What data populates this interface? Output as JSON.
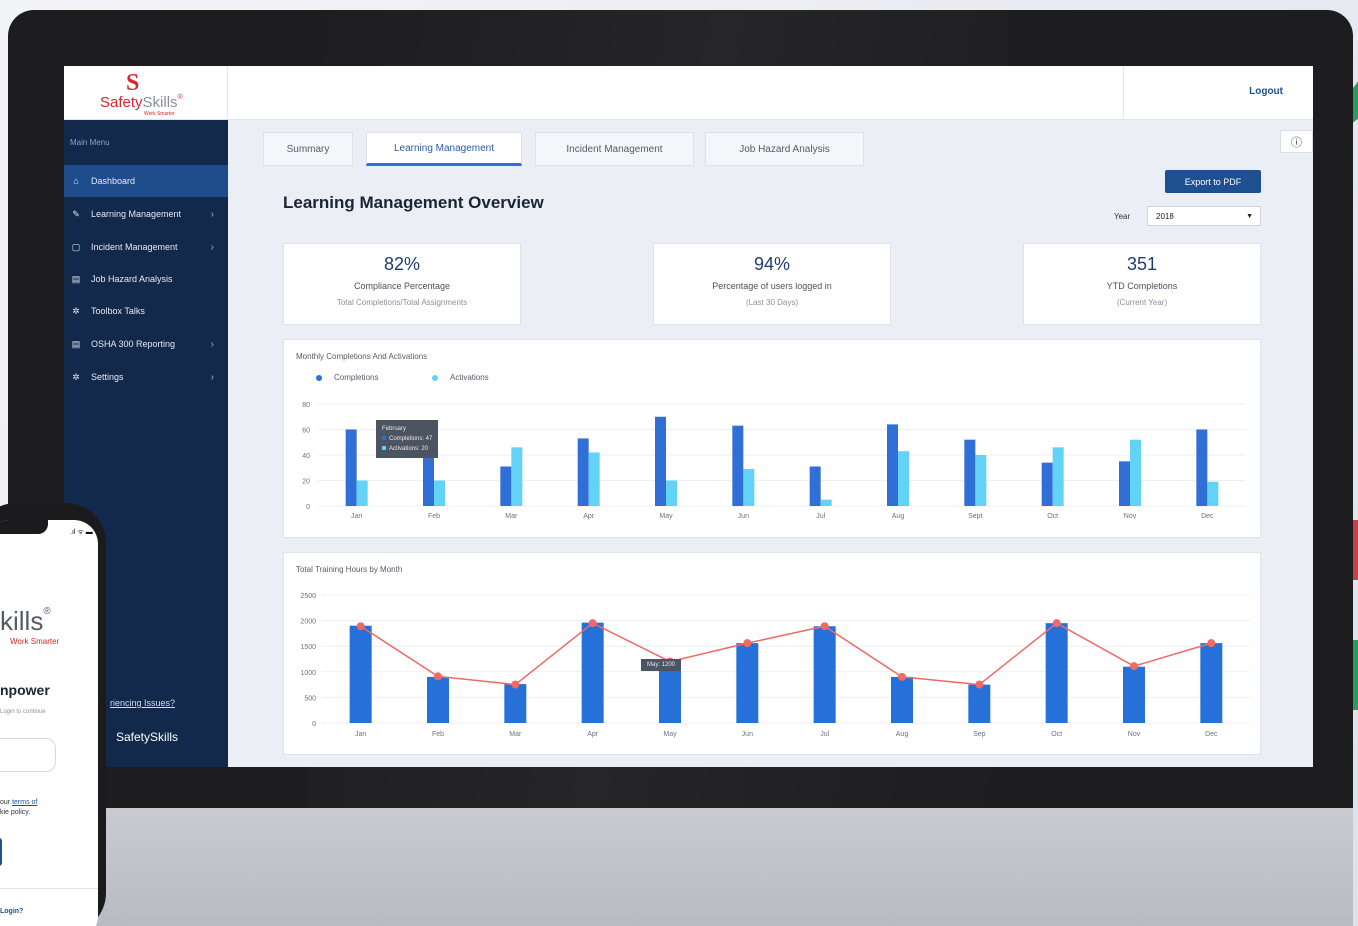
{
  "app": {
    "logo_mark": "S",
    "logo_brand_a": "Safety",
    "logo_brand_b": "Skills",
    "logo_registered": "®",
    "logo_tagline": "Work Smarter",
    "logout": "Logout"
  },
  "sidebar": {
    "heading": "Main Menu",
    "items": [
      {
        "label": "Dashboard",
        "icon": "home-icon",
        "glyph": "⌂",
        "chevron": ""
      },
      {
        "label": "Learning Management",
        "icon": "graduation-cap-icon",
        "glyph": "✎",
        "chevron": "›"
      },
      {
        "label": "Incident Management",
        "icon": "square-icon",
        "glyph": "▢",
        "chevron": "›"
      },
      {
        "label": "Job Hazard Analysis",
        "icon": "clipboard-icon",
        "glyph": "▤",
        "chevron": ""
      },
      {
        "label": "Toolbox Talks",
        "icon": "gear-icon",
        "glyph": "✲",
        "chevron": ""
      },
      {
        "label": "OSHA 300 Reporting",
        "icon": "document-icon",
        "glyph": "▤",
        "chevron": "›"
      },
      {
        "label": "Settings",
        "icon": "settings-icon",
        "glyph": "✲",
        "chevron": "›"
      }
    ],
    "issues_link": "riencing Issues?",
    "footer_logo": "SafetySkills"
  },
  "tabs": [
    {
      "label": "Summary"
    },
    {
      "label": "Learning Management"
    },
    {
      "label": "Incident Management"
    },
    {
      "label": "Job Hazard Analysis"
    }
  ],
  "info_glyph": "ⓘ",
  "page_title": "Learning Management Overview",
  "export_label": "Export to PDF",
  "year": {
    "label": "Year",
    "value": "2018",
    "caret": "▼"
  },
  "kpis": [
    {
      "value": "82%",
      "label": "Compliance Percentage",
      "sub": "Total Completions/Total Assignments"
    },
    {
      "value": "94%",
      "label": "Percentage of users logged in",
      "sub": "(Last 30 Days)"
    },
    {
      "value": "351",
      "label": "YTD Completions",
      "sub": "(Current Year)"
    }
  ],
  "colors": {
    "completions": "#2f6fd6",
    "activations": "#62d3f7",
    "hours_bar": "#2571d9",
    "hours_line": "#ef6a66"
  },
  "chart_data": [
    {
      "type": "bar",
      "title": "Monthly Completions And Activations",
      "categories": [
        "Jan",
        "Feb",
        "Mar",
        "Apr",
        "May",
        "Jun",
        "Jul",
        "Aug",
        "Sept",
        "Oct",
        "Nov",
        "Dec"
      ],
      "series": [
        {
          "name": "Completions",
          "values": [
            60,
            47,
            31,
            53,
            70,
            63,
            31,
            64,
            52,
            34,
            35,
            60
          ]
        },
        {
          "name": "Activations",
          "values": [
            20,
            20,
            46,
            42,
            20,
            29,
            5,
            43,
            40,
            46,
            52,
            19
          ]
        }
      ],
      "yticks": [
        0,
        20,
        40,
        60,
        80
      ],
      "ylim": [
        0,
        80
      ],
      "grid": true,
      "legend": "top-left",
      "tooltip": {
        "title": "February",
        "lines": [
          "Completions: 47",
          "Activations: 20"
        ]
      }
    },
    {
      "type": "bar",
      "title": "Total Training Hours by Month",
      "categories": [
        "Jan",
        "Feb",
        "Mar",
        "Apr",
        "May",
        "Jun",
        "Jul",
        "Aug",
        "Sep",
        "Oct",
        "Nov",
        "Dec"
      ],
      "series": [
        {
          "name": "Hours",
          "values": [
            1900,
            900,
            760,
            1960,
            1200,
            1560,
            1890,
            900,
            750,
            1950,
            1100,
            1560
          ]
        },
        {
          "name": "Trend",
          "values": [
            1890,
            910,
            750,
            1950,
            1200,
            1560,
            1890,
            900,
            750,
            1950,
            1110,
            1560
          ]
        }
      ],
      "yticks": [
        0,
        500,
        1000,
        1500,
        2000,
        2500
      ],
      "ylim": [
        0,
        2500
      ],
      "grid": true,
      "tooltip": {
        "title": "",
        "lines": [
          "May: 1200"
        ]
      }
    }
  ],
  "phone": {
    "status": ".ıl ᯤ ▬",
    "brand": "kills",
    "registered": "®",
    "tagline": "Work Smarter",
    "headline": "npower",
    "login_hint": "Login to continue",
    "terms_a": "our",
    "terms_link": "terms of",
    "terms_b": "kie policy.",
    "login_link": "Login?"
  }
}
